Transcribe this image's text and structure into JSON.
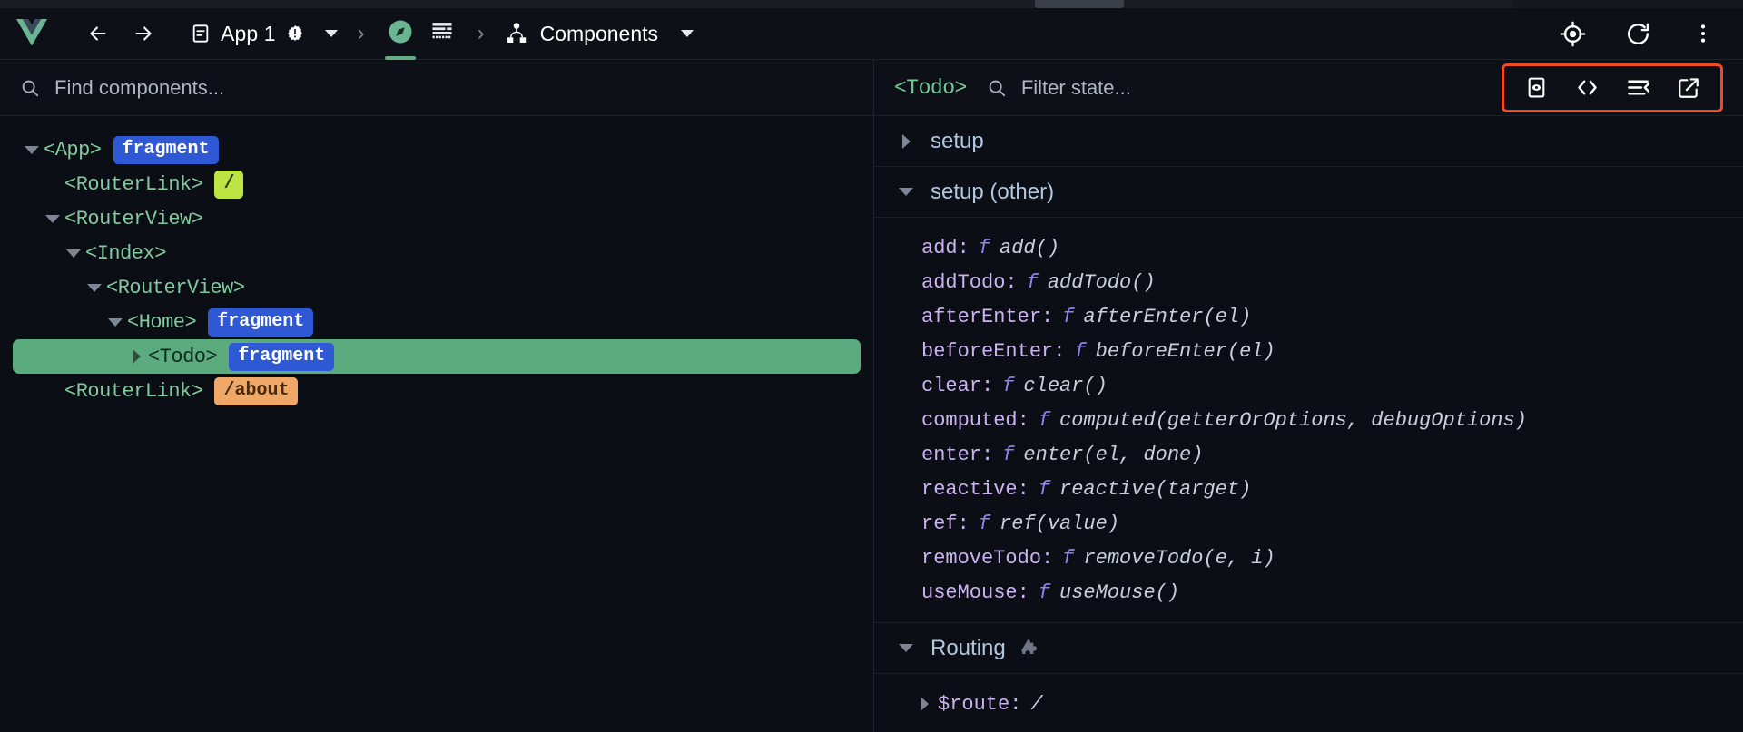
{
  "window": {
    "title": "Vue DevTools"
  },
  "toolbar": {
    "back_label": "Back",
    "forward_label": "Forward",
    "app_selector": {
      "label": "App 1",
      "icon": "document-icon",
      "warning_icon": "warning-badge-icon",
      "caret": "chevron-down-icon"
    },
    "inspector_tab": {
      "name": "compass-icon",
      "active": true
    },
    "timeline_tab": {
      "name": "list-rows-icon",
      "active": false
    },
    "page_selector": {
      "label": "Components",
      "icon": "component-tree-icon",
      "caret": "chevron-down-icon"
    },
    "right_icons": [
      {
        "name": "target-locate-icon",
        "label": "Locate component"
      },
      {
        "name": "refresh-icon",
        "label": "Refresh"
      },
      {
        "name": "more-vertical-icon",
        "label": "More options"
      }
    ],
    "separator": "›"
  },
  "left_pane": {
    "search": {
      "placeholder": "Find components...",
      "value": "",
      "icon": "search-icon"
    },
    "tree": [
      {
        "name": "<App>",
        "depth": 0,
        "twisty": "down",
        "badge": {
          "text": "fragment",
          "kind": "fragment"
        },
        "selected": false
      },
      {
        "name": "<RouterLink>",
        "depth": 1,
        "twisty": "none",
        "badge": {
          "text": "/",
          "kind": "route-home"
        },
        "selected": false
      },
      {
        "name": "<RouterView>",
        "depth": 1,
        "twisty": "down",
        "badge": null,
        "selected": false
      },
      {
        "name": "<Index>",
        "depth": 2,
        "twisty": "down",
        "badge": null,
        "selected": false
      },
      {
        "name": "<RouterView>",
        "depth": 3,
        "twisty": "down",
        "badge": null,
        "selected": false
      },
      {
        "name": "<Home>",
        "depth": 4,
        "twisty": "down",
        "badge": {
          "text": "fragment",
          "kind": "fragment"
        },
        "selected": false
      },
      {
        "name": "<Todo>",
        "depth": 5,
        "twisty": "right",
        "badge": {
          "text": "fragment",
          "kind": "fragment"
        },
        "selected": true
      },
      {
        "name": "<RouterLink>",
        "depth": 1,
        "twisty": "none",
        "badge": {
          "text": "/about",
          "kind": "route-about"
        },
        "selected": false
      }
    ]
  },
  "right_pane": {
    "selected_component": "<Todo>",
    "filter": {
      "placeholder": "Filter state...",
      "value": "",
      "icon": "search-icon"
    },
    "actions": [
      {
        "name": "scroll-into-view-icon",
        "label": "Scroll to component"
      },
      {
        "name": "open-in-editor-icon",
        "label": "Inspect source code"
      },
      {
        "name": "collapse-all-icon",
        "label": "Collapse all"
      },
      {
        "name": "open-external-icon",
        "label": "Open in new window"
      }
    ],
    "actions_highlight_color": "#f04a23",
    "sections": [
      {
        "title": "setup",
        "expanded": false,
        "icon": null,
        "props": []
      },
      {
        "title": "setup (other)",
        "expanded": true,
        "icon": null,
        "props": [
          {
            "key": "add",
            "fn": "f",
            "signature": "add()"
          },
          {
            "key": "addTodo",
            "fn": "f",
            "signature": "addTodo()"
          },
          {
            "key": "afterEnter",
            "fn": "f",
            "signature": "afterEnter(el)"
          },
          {
            "key": "beforeEnter",
            "fn": "f",
            "signature": "beforeEnter(el)"
          },
          {
            "key": "clear",
            "fn": "f",
            "signature": "clear()"
          },
          {
            "key": "computed",
            "fn": "f",
            "signature": "computed(getterOrOptions, debugOptions)"
          },
          {
            "key": "enter",
            "fn": "f",
            "signature": "enter(el, done)"
          },
          {
            "key": "reactive",
            "fn": "f",
            "signature": "reactive(target)"
          },
          {
            "key": "ref",
            "fn": "f",
            "signature": "ref(value)"
          },
          {
            "key": "removeTodo",
            "fn": "f",
            "signature": "removeTodo(e, i)"
          },
          {
            "key": "useMouse",
            "fn": "f",
            "signature": "useMouse()"
          }
        ]
      },
      {
        "title": "Routing",
        "expanded": true,
        "icon": "puzzle-icon",
        "props": [
          {
            "key": "$route",
            "fn": null,
            "signature": "/"
          }
        ]
      }
    ]
  },
  "colors": {
    "background": "#0b0e14",
    "toolbar_bg": "#0d1016",
    "accent_green": "#62ad86",
    "selected_row": "#5bab7f",
    "tag_green": "#82c99f",
    "key_purple": "#cbb3f2",
    "badge_blue": "#2f59d4",
    "badge_lime": "#bde443",
    "badge_orange": "#f0a868",
    "highlight_red": "#f04a23"
  }
}
